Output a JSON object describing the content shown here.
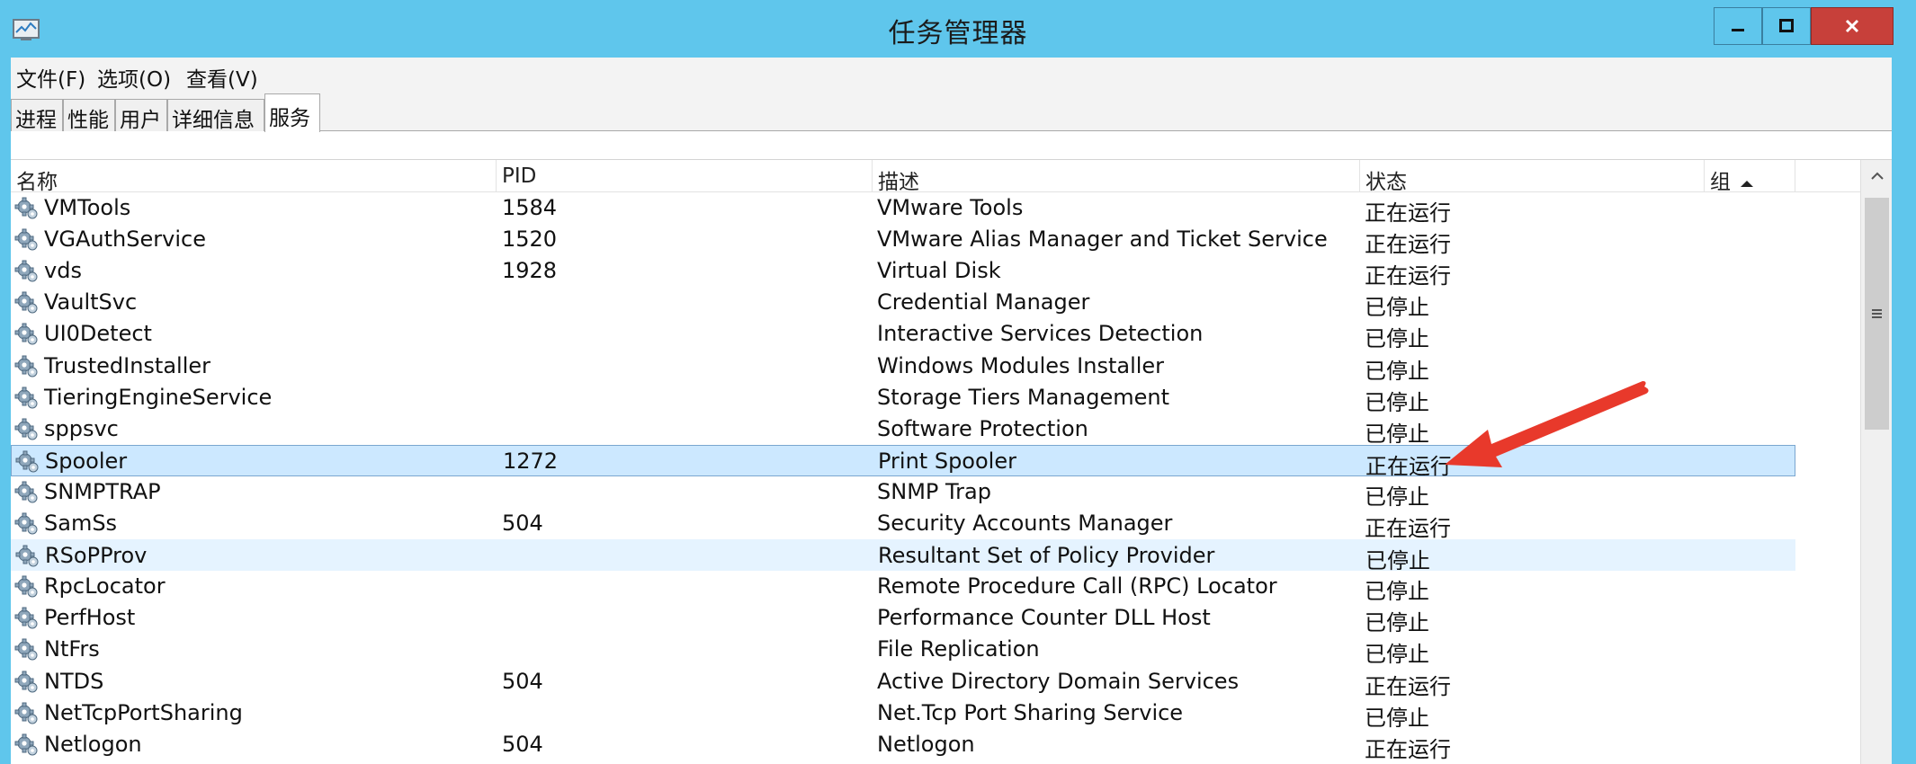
{
  "window": {
    "title": "任务管理器",
    "controls": {
      "minimize": "minimize",
      "maximize": "maximize",
      "close": "close"
    }
  },
  "menu": [
    "文件(F)",
    "选项(O)",
    "查看(V)"
  ],
  "tabs": [
    {
      "label": "进程",
      "active": false
    },
    {
      "label": "性能",
      "active": false
    },
    {
      "label": "用户",
      "active": false
    },
    {
      "label": "详细信息",
      "active": false
    },
    {
      "label": "服务",
      "active": true
    }
  ],
  "columns": {
    "name": "名称",
    "pid": "PID",
    "description": "描述",
    "status": "状态",
    "group": "组"
  },
  "sort": {
    "column": "group",
    "direction": "ascending"
  },
  "services": [
    {
      "name": "VMTools",
      "pid": "1584",
      "description": "VMware Tools",
      "status": "正在运行"
    },
    {
      "name": "VGAuthService",
      "pid": "1520",
      "description": "VMware Alias Manager and Ticket Service",
      "status": "正在运行"
    },
    {
      "name": "vds",
      "pid": "1928",
      "description": "Virtual Disk",
      "status": "正在运行"
    },
    {
      "name": "VaultSvc",
      "pid": "",
      "description": "Credential Manager",
      "status": "已停止"
    },
    {
      "name": "UI0Detect",
      "pid": "",
      "description": "Interactive Services Detection",
      "status": "已停止"
    },
    {
      "name": "TrustedInstaller",
      "pid": "",
      "description": "Windows Modules Installer",
      "status": "已停止"
    },
    {
      "name": "TieringEngineService",
      "pid": "",
      "description": "Storage Tiers Management",
      "status": "已停止"
    },
    {
      "name": "sppsvc",
      "pid": "",
      "description": "Software Protection",
      "status": "已停止"
    },
    {
      "name": "Spooler",
      "pid": "1272",
      "description": "Print Spooler",
      "status": "正在运行",
      "selected": true
    },
    {
      "name": "SNMPTRAP",
      "pid": "",
      "description": "SNMP Trap",
      "status": "已停止"
    },
    {
      "name": "SamSs",
      "pid": "504",
      "description": "Security Accounts Manager",
      "status": "正在运行"
    },
    {
      "name": "RSoPProv",
      "pid": "",
      "description": "Resultant Set of Policy Provider",
      "status": "已停止",
      "hover": true
    },
    {
      "name": "RpcLocator",
      "pid": "",
      "description": "Remote Procedure Call (RPC) Locator",
      "status": "已停止"
    },
    {
      "name": "PerfHost",
      "pid": "",
      "description": "Performance Counter DLL Host",
      "status": "已停止"
    },
    {
      "name": "NtFrs",
      "pid": "",
      "description": "File Replication",
      "status": "已停止"
    },
    {
      "name": "NTDS",
      "pid": "504",
      "description": "Active Directory Domain Services",
      "status": "正在运行"
    },
    {
      "name": "NetTcpPortSharing",
      "pid": "",
      "description": "Net.Tcp Port Sharing Service",
      "status": "已停止"
    },
    {
      "name": "Netlogon",
      "pid": "504",
      "description": "Netlogon",
      "status": "正在运行"
    }
  ],
  "icons": {
    "service": "gear-service-icon",
    "app": "task-manager-icon"
  },
  "colors": {
    "titlebar": "#5fc6ec",
    "close": "#c7403a",
    "selection": "#cce8ff",
    "annotation": "#e8392b"
  }
}
